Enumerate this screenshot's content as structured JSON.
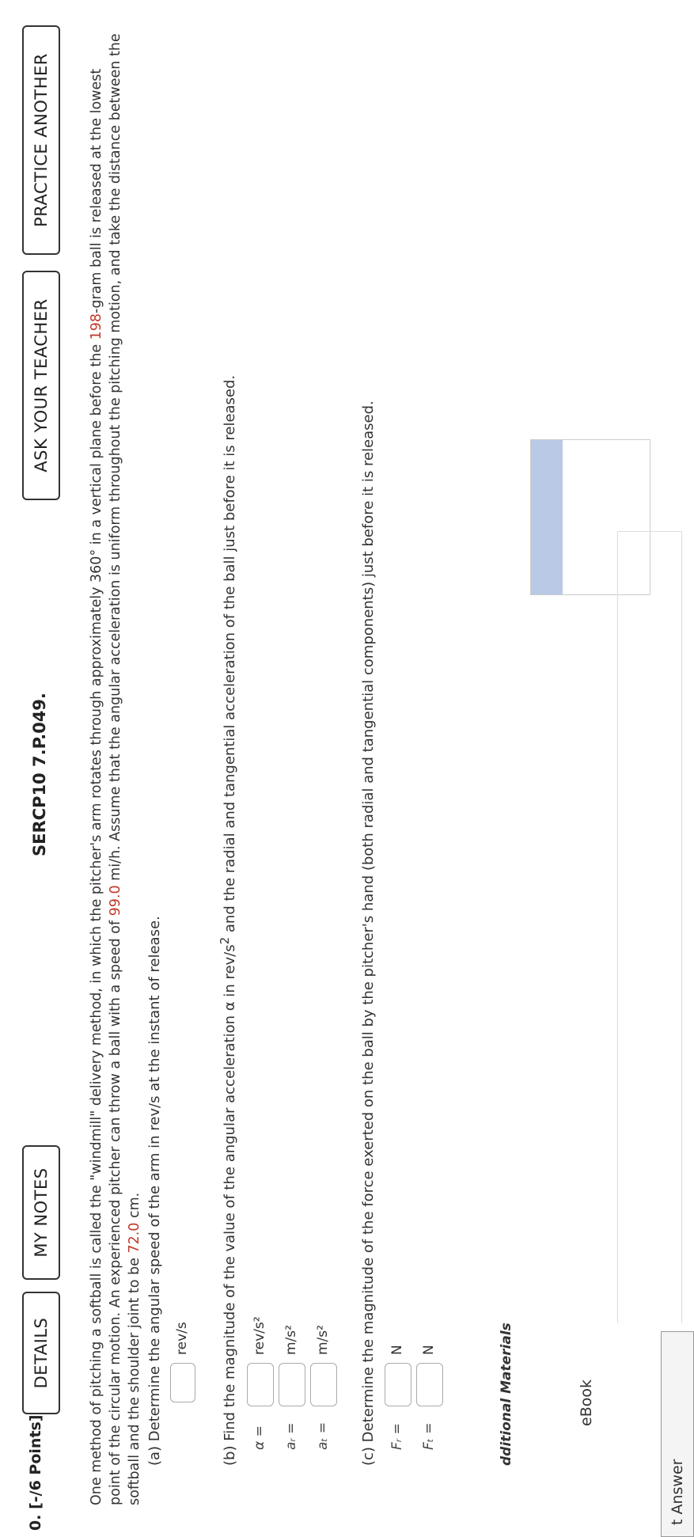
{
  "question": {
    "number": "0.",
    "points": "[-/6 Points]",
    "code": "SERCP10 7.P.049."
  },
  "buttons": {
    "details": "DETAILS",
    "my_notes": "MY NOTES",
    "ask_teacher": "ASK YOUR TEACHER",
    "practice_another": "PRACTICE ANOTHER"
  },
  "problem": {
    "text_before_mass": "One method of pitching a softball is called the \"windmill\" delivery method, in which the pitcher's arm rotates through approximately 360° in a vertical plane before the ",
    "mass": "198",
    "text_after_mass": "-gram ball is released at the lowest point of the circular motion. An experienced pitcher can throw a ball with a speed of ",
    "speed": "99.0",
    "text_after_speed": " mi/h. Assume that the angular acceleration is uniform throughout the pitching motion, and take the distance between the softball and the shoulder joint to be ",
    "distance": "72.0",
    "text_end": " cm."
  },
  "part_a": {
    "prompt": "(a) Determine the angular speed of the arm in rev/s at the instant of release.",
    "unit": "rev/s"
  },
  "part_b": {
    "prompt_start": "(b) Find the magnitude of the value of the angular acceleration α in rev/s",
    "prompt_end": " and the radial and tangential acceleration of the ball just before it is released.",
    "rows": [
      {
        "label": "α =",
        "unit": "rev/s²"
      },
      {
        "label": "aᵣ =",
        "unit": "m/s²"
      },
      {
        "label": "aₜ =",
        "unit": "m/s²"
      }
    ]
  },
  "part_c": {
    "prompt": "(c) Determine the magnitude of the force exerted on the ball by the pitcher's hand (both radial and tangential components) just before it is released.",
    "rows": [
      {
        "label": "Fᵣ =",
        "unit": "N"
      },
      {
        "label": "Fₜ =",
        "unit": "N"
      }
    ]
  },
  "footer": {
    "additional_materials": "dditional Materials",
    "ebook": "eBook",
    "answer": "t Answer"
  }
}
